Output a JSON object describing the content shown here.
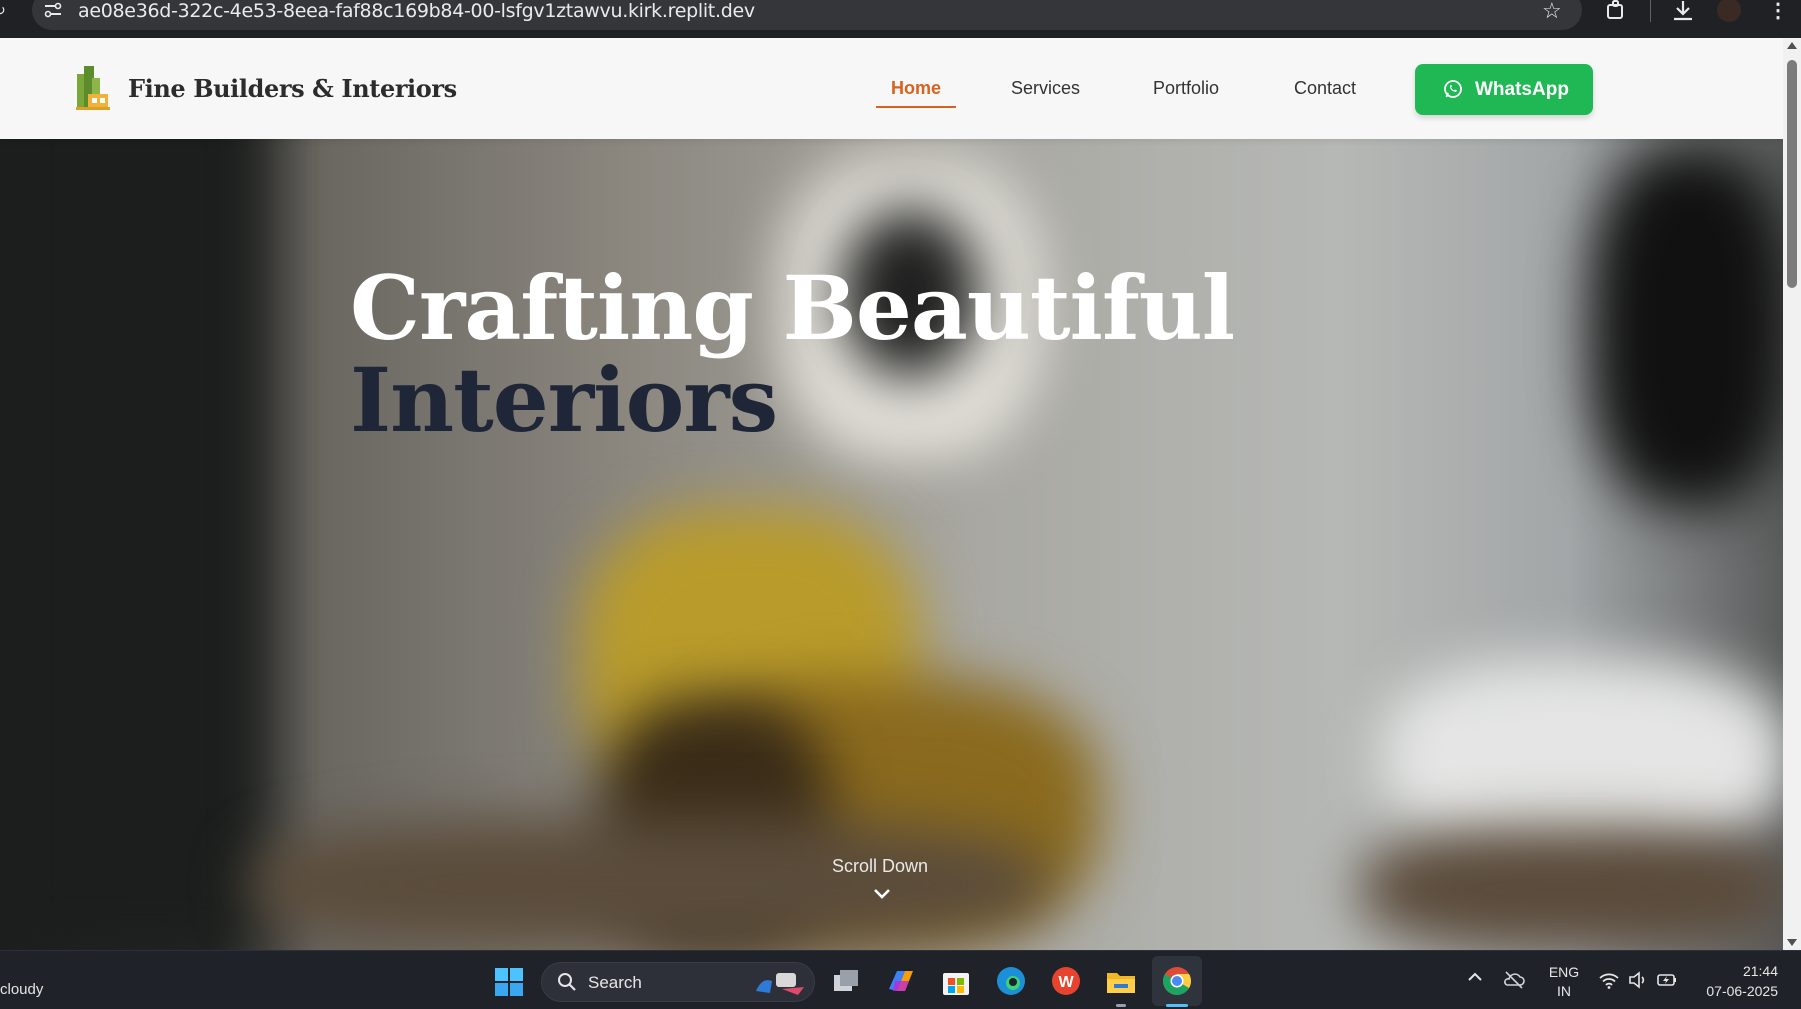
{
  "browser": {
    "url": "ae08e36d-322c-4e53-8eea-faf88c169b84-00-lsfgv1ztawvu.kirk.replit.dev",
    "icons": [
      "reload-icon",
      "site-info-icon",
      "star-icon",
      "extensions-icon",
      "download-icon",
      "profile-avatar",
      "menu-icon"
    ]
  },
  "navbar": {
    "brand": "Fine Builders & Interiors",
    "links": [
      {
        "label": "Home",
        "active": true
      },
      {
        "label": "Services",
        "active": false
      },
      {
        "label": "Portfolio",
        "active": false
      },
      {
        "label": "Contact",
        "active": false
      }
    ],
    "whatsapp_label": "WhatsApp"
  },
  "hero": {
    "title_light": "Crafting Beautiful ",
    "title_dark": "Interiors",
    "scroll_label": "Scroll Down"
  },
  "taskbar": {
    "weather": "cloudy",
    "search_label": "Search",
    "lang_top": "ENG",
    "lang_bottom": "IN",
    "time": "21:44",
    "date": "07-06-2025",
    "apps": [
      "task-view-icon",
      "copilot-icon",
      "microsoft-store-icon",
      "edge-icon",
      "wps-office-icon",
      "file-explorer-icon",
      "chrome-icon"
    ]
  },
  "colors": {
    "accent": "#d9621f",
    "whatsapp_green": "#1fb854",
    "hero_dark_text": "#1f2638"
  }
}
